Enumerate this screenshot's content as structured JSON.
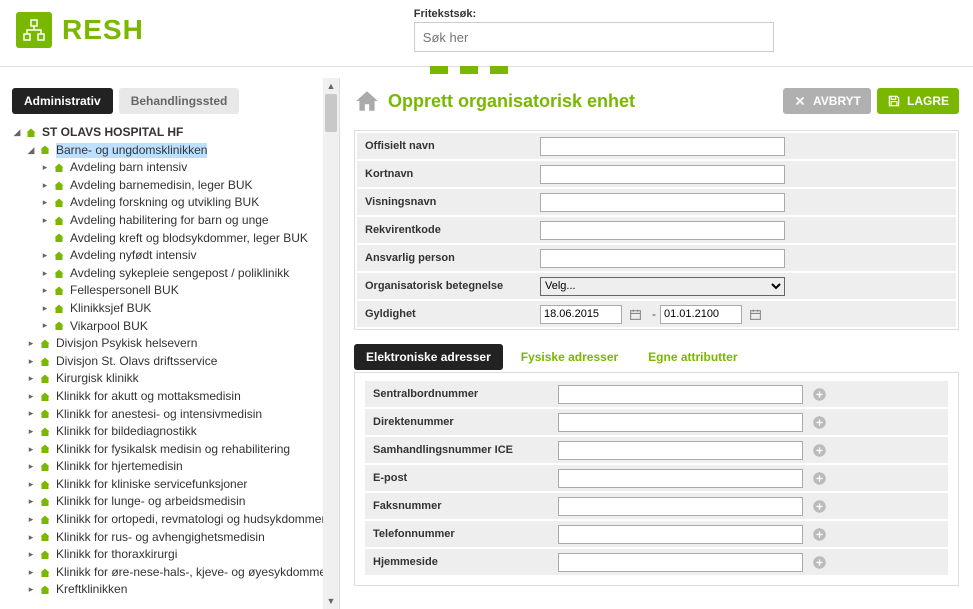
{
  "header": {
    "logo_text": "RESH",
    "search_label": "Fritekstsøk:",
    "search_placeholder": "Søk her"
  },
  "sidebar": {
    "tabs": [
      {
        "label": "Administrativ",
        "active": true
      },
      {
        "label": "Behandlingssted",
        "active": false
      }
    ],
    "tree_root": "ST OLAVS HOSPITAL HF",
    "selected": "Barne- og ungdomsklinikken",
    "selected_children": [
      "Avdeling barn intensiv",
      "Avdeling barnemedisin, leger BUK",
      "Avdeling forskning og utvikling BUK",
      "Avdeling habilitering for barn og unge",
      "Avdeling kreft og blodsykdommer, leger BUK",
      "Avdeling nyfødt intensiv",
      "Avdeling sykepleie sengepost / poliklinikk",
      "Fellespersonell BUK",
      "Klinikksjef BUK",
      "Vikarpool BUK"
    ],
    "siblings": [
      "Divisjon Psykisk helsevern",
      "Divisjon St. Olavs driftsservice",
      "Kirurgisk klinikk",
      "Klinikk for akutt og mottaksmedisin",
      "Klinikk for anestesi- og intensivmedisin",
      "Klinikk for bildediagnostikk",
      "Klinikk for fysikalsk medisin og rehabilitering",
      "Klinikk for hjertemedisin",
      "Klinikk for kliniske servicefunksjoner",
      "Klinikk for lunge- og arbeidsmedisin",
      "Klinikk for ortopedi, revmatologi og hudsykdommer",
      "Klinikk for rus- og avhengighetsmedisin",
      "Klinikk for thoraxkirurgi",
      "Klinikk for øre-nese-hals-, kjeve- og øyesykdommer",
      "Kreftklinikken"
    ]
  },
  "main": {
    "title": "Opprett organisatorisk enhet",
    "btn_cancel": "AVBRYT",
    "btn_save": "LAGRE",
    "fields": {
      "offisielt_navn": "Offisielt navn",
      "kortnavn": "Kortnavn",
      "visningsnavn": "Visningsnavn",
      "rekvirentkode": "Rekvirentkode",
      "ansvarlig_person": "Ansvarlig person",
      "org_betegnelse": "Organisatorisk betegnelse",
      "org_betegnelse_value": "Velg...",
      "gyldighet": "Gyldighet",
      "date_from": "18.06.2015",
      "date_to": "01.01.2100"
    },
    "subtabs": [
      {
        "label": "Elektroniske adresser",
        "active": true
      },
      {
        "label": "Fysiske adresser",
        "active": false
      },
      {
        "label": "Egne attributter",
        "active": false
      }
    ],
    "subfields": [
      "Sentralbordnummer",
      "Direktenummer",
      "Samhandlingsnummer ICE",
      "E-post",
      "Faksnummer",
      "Telefonnummer",
      "Hjemmeside"
    ]
  }
}
